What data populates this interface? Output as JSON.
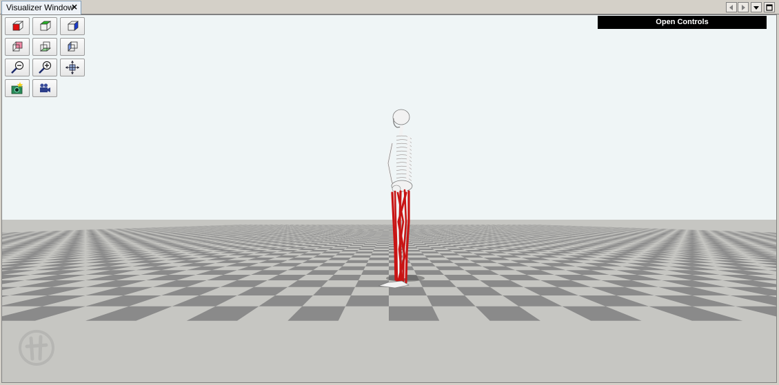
{
  "tab": {
    "title": "Visualizer Window",
    "close_glyph": "×"
  },
  "window_buttons": [
    "scroll-left-icon",
    "scroll-right-icon",
    "dropdown-icon",
    "maximize-icon"
  ],
  "toolbar": {
    "rows": [
      [
        "front-view-icon",
        "top-view-icon",
        "right-view-icon"
      ],
      [
        "back-view-icon",
        "bottom-view-icon",
        "left-view-icon"
      ],
      [
        "zoom-out-icon",
        "zoom-in-icon",
        "fit-view-icon"
      ],
      [
        "snapshot-icon",
        "record-movie-icon"
      ]
    ]
  },
  "controls": {
    "open_label": "Open Controls"
  },
  "scene": {
    "sky_color": "#eff5f6",
    "tile_dark": "#8a8a8a",
    "tile_light": "#c6c6c2",
    "muscle_color": "#c81414",
    "bone_color": "#f2f2f2"
  }
}
